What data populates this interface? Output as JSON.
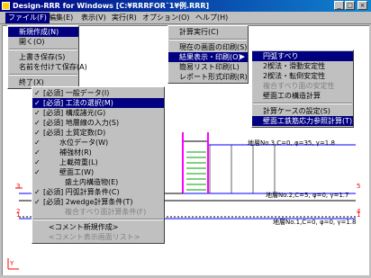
{
  "window": {
    "title": "Design-RRR for Windows [C:¥RRRFOR¯1¥例.RRR]",
    "minimize": "_",
    "maximize": "□",
    "close": "×"
  },
  "menubar": [
    {
      "label": "ファイル(F)"
    },
    {
      "label": "編集(E)"
    },
    {
      "label": "表示(V)"
    },
    {
      "label": "実行(R)"
    },
    {
      "label": "オプション(O)"
    },
    {
      "label": "ヘルプ(H)"
    }
  ],
  "file_menu": {
    "items": [
      "新規作成(N)",
      "開く(O)",
      "上書き保存(S)",
      "名前を付けて保存(A)",
      "終了(X)"
    ]
  },
  "edit_menu": {
    "items": [
      {
        "label": "[必須] 一般データ(I)",
        "check": "✓"
      },
      {
        "label": "[必須] 工法の選択(M)",
        "check": "✓"
      },
      {
        "label": "[必須] 構成諸元(G)",
        "check": "✓"
      },
      {
        "label": "[必須] 地層線の入力(S)",
        "check": "✓"
      },
      {
        "label": "[必須] 土質定数(D)",
        "check": "✓"
      },
      {
        "label": "水位データ(W)",
        "check": "✓"
      },
      {
        "label": "補強材(R)",
        "check": "✓"
      },
      {
        "label": "上載荷重(L)",
        "check": "✓"
      },
      {
        "label": "壁面工(W)",
        "check": "✓"
      },
      {
        "label": "盛土内構造物(E)",
        "check": ""
      },
      {
        "label": "[必須] 円弧計算条件(C)",
        "check": "✓"
      },
      {
        "label": "[必須] 2wedge計算条件(T)",
        "check": "✓"
      },
      {
        "label": "複合すべり面計算条件(F)",
        "check": ""
      },
      {
        "label": "<コメント新規作成>",
        "check": ""
      },
      {
        "label": "<コメント表示画面リスト>",
        "check": ""
      }
    ]
  },
  "run_menu": {
    "items": [
      "計算実行(C)",
      "現在の画面の印刷(S)",
      "結果表示・印刷(O)",
      "簡易リスト印刷(L)",
      "レポート形式印刷(R)"
    ]
  },
  "result_submenu": {
    "items": [
      "円弧すべり",
      "2楔法・滑動安定性",
      "2楔法・転倒安定性",
      "複合すべり面の安定性",
      "壁面工の構造計算",
      "計算ケースの設定(S)",
      "壁面工鉄筋応力参照計算(T)"
    ]
  },
  "drawing": {
    "layer_labels": [
      "地層No.3,C=0, φ=35, γ=1.8",
      "地層No.2,C=5, φ=0, γ=1.7",
      "地層No.1,C=0, φ=0, γ=1.8"
    ],
    "marker_labels": [
      "3",
      "2",
      "1",
      "5",
      "4",
      "1"
    ],
    "origin_label": "Y"
  },
  "colors": {
    "title_start": "#000080",
    "title_end": "#1084d0",
    "menu_highlight": "#000080",
    "layer_line": "#0000ff",
    "marker": "#ff0000",
    "wall": "#ff00ff",
    "reinforcement": "#00a000"
  }
}
